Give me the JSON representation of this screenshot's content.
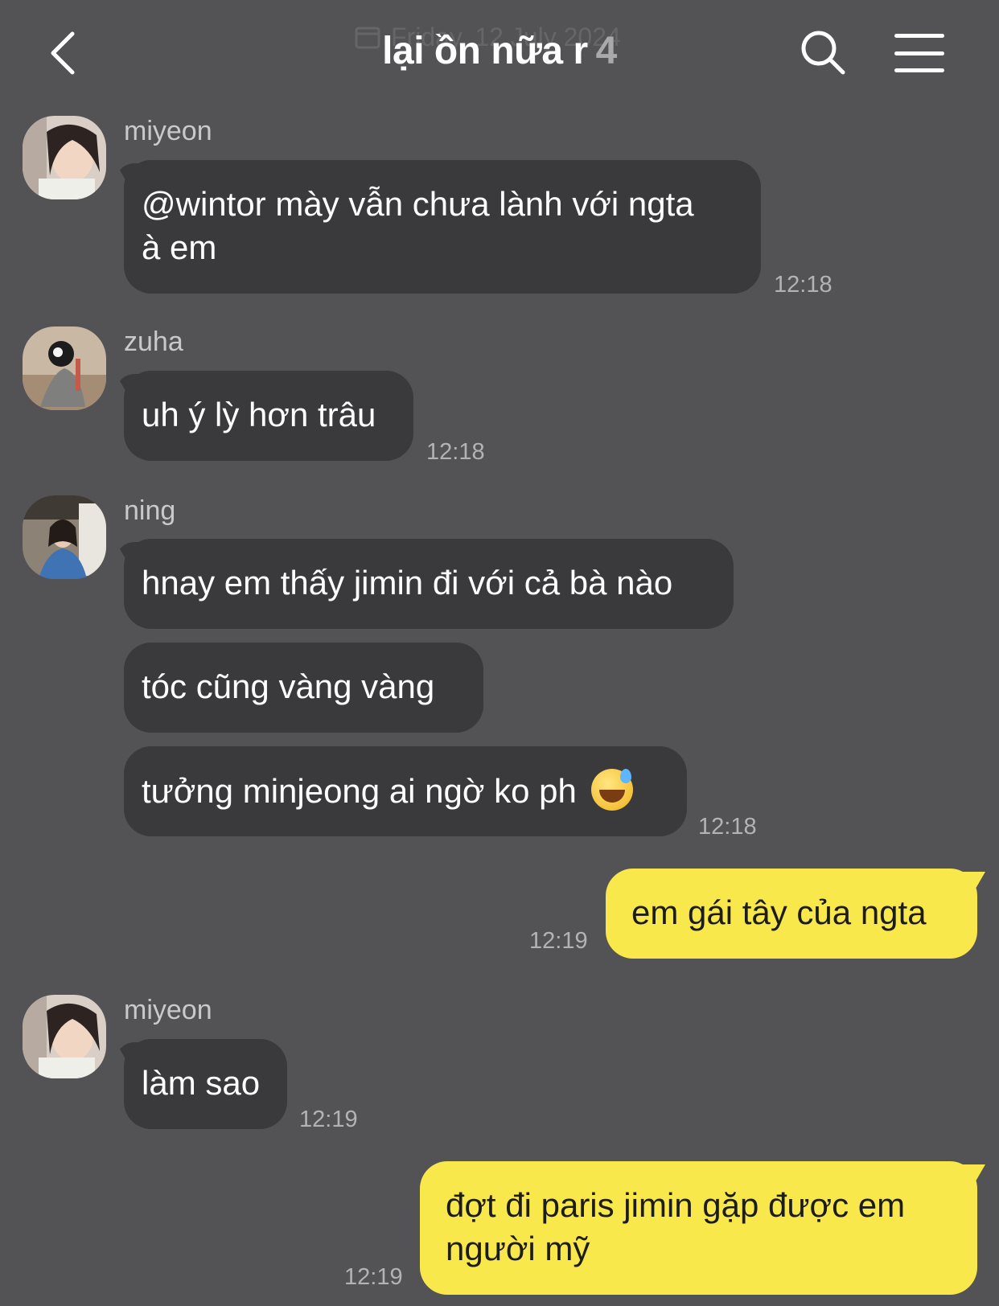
{
  "header": {
    "back_icon": "chevron-left-icon",
    "date_label": "Friday, 12 July 2024",
    "title": "lại ồn nữa r",
    "member_count": "4",
    "search_icon": "search-icon",
    "menu_icon": "hamburger-menu-icon"
  },
  "messages": [
    {
      "sender": "miyeon",
      "lines": [
        "@wintor mày vẫn chưa lành với ngta",
        "à em"
      ],
      "time": "12:18"
    },
    {
      "sender": "zuha",
      "text": "uh ý lỳ hơn trâu",
      "time": "12:18"
    },
    {
      "sender": "ning",
      "texts": [
        "hnay em thấy jimin đi với cả bà nào",
        "tóc cũng vàng vàng",
        "tưởng minjeong ai ngờ ko ph"
      ],
      "emoji": "grinning-face-with-sweat",
      "time": "12:18"
    },
    {
      "sender": "me",
      "text": "em gái tây của ngta",
      "time": "12:19"
    },
    {
      "sender": "miyeon",
      "text": "làm sao",
      "time": "12:19"
    },
    {
      "sender": "me",
      "lines": [
        "đợt đi paris jimin gặp được em",
        "người mỹ"
      ],
      "time": "12:19"
    }
  ],
  "colors": {
    "background": "#535255",
    "bubble_other": "#3a393c",
    "bubble_mine": "#f9e84b"
  }
}
